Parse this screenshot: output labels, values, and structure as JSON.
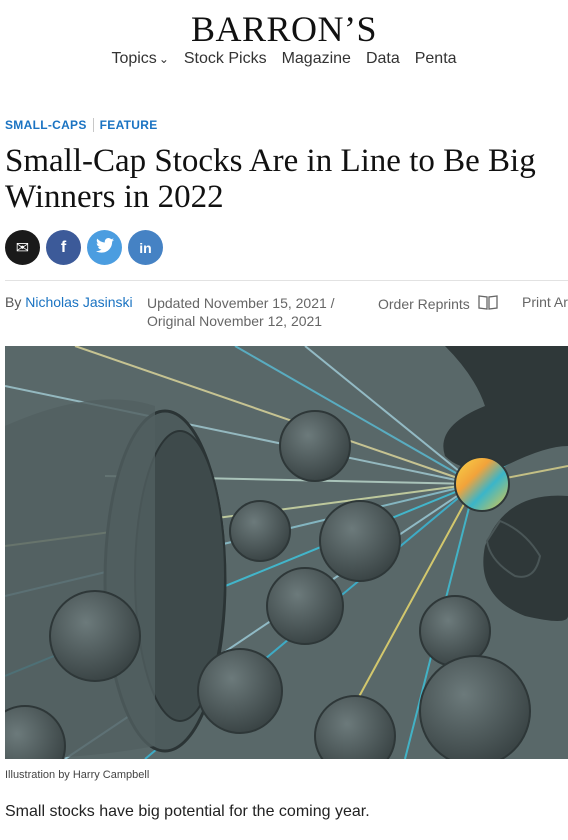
{
  "brand": {
    "logo": "BARRON’S"
  },
  "nav": {
    "items": [
      {
        "label": "Topics",
        "has_dropdown": true
      },
      {
        "label": "Stock Picks"
      },
      {
        "label": "Magazine"
      },
      {
        "label": "Data"
      },
      {
        "label": "Penta"
      }
    ]
  },
  "article": {
    "kickers": [
      "SMALL-CAPS",
      "FEATURE"
    ],
    "headline": "Small-Cap Stocks Are in Line to Be Big Winners in 2022",
    "byline_prefix": "By",
    "author": "Nicholas Jasinski",
    "updated": "Updated November 15, 2021 /",
    "original": "Original November 12, 2021",
    "order_reprints": "Order Reprints",
    "print_article": "Print Ar",
    "caption": "Illustration by Harry Campbell",
    "lede": "Small stocks have big potential for the coming year."
  },
  "share": {
    "email_icon": "✉",
    "facebook_icon": "f",
    "twitter_icon": "t",
    "linkedin_icon": "in"
  },
  "colors": {
    "kicker": "#1a73c2",
    "author_link": "#1a73c2",
    "facebook": "#3c5a99",
    "twitter": "#4b9de0",
    "linkedin": "#4582c4",
    "illustration_bg": "#5c6a6b"
  }
}
